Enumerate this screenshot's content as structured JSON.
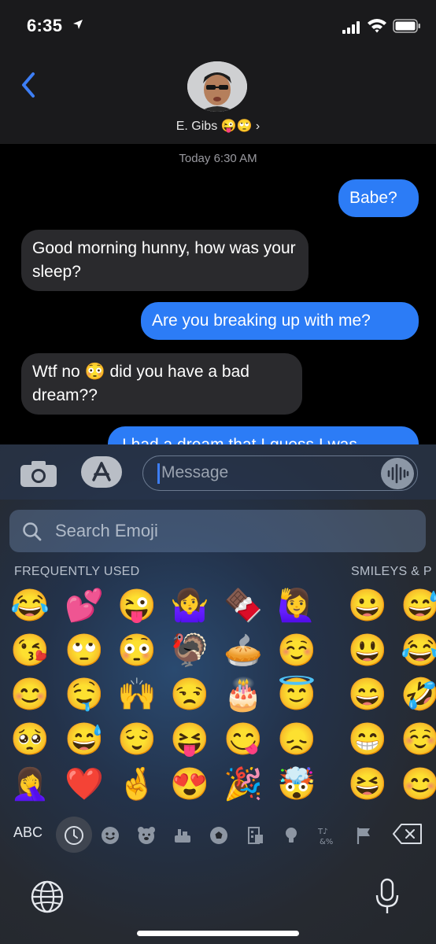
{
  "status_bar": {
    "time": "6:35"
  },
  "header": {
    "contact_name": "E. Gibs 😜🙄 ›"
  },
  "conversation": {
    "timestamp": "Today 6:30 AM",
    "messages": [
      {
        "from": "me",
        "text": "Babe?"
      },
      {
        "from": "them",
        "text": "Good morning hunny, how was your sleep?"
      },
      {
        "from": "me",
        "text": "Are you breaking up with me?"
      },
      {
        "from": "them",
        "text": "Wtf no 😳 did you have a bad dream??"
      },
      {
        "from": "me",
        "text": "I had a dream that I guess I was"
      }
    ]
  },
  "composer": {
    "placeholder": "Message"
  },
  "emoji_keyboard": {
    "search_placeholder": "Search Emoji",
    "section_frequent": "FREQUENTLY USED",
    "section_smileys": "SMILEYS & P",
    "frequent_rows": [
      [
        "😂",
        "💕",
        "😜",
        "🤷‍♀️",
        "🍫",
        "🙋‍♀️"
      ],
      [
        "😘",
        "🙄",
        "😳",
        "🦃",
        "🥧",
        "☺️"
      ],
      [
        "😊",
        "🤤",
        "🙌",
        "😒",
        "🎂",
        "😇"
      ],
      [
        "🥺",
        "😅",
        "😌",
        "😝",
        "😋",
        "😞"
      ],
      [
        "🤦‍♀️",
        "❤️",
        "🤞",
        "😍",
        "🎉",
        "🤯"
      ]
    ],
    "smileys_rows": [
      [
        "😀",
        "😅"
      ],
      [
        "😃",
        "😂"
      ],
      [
        "😄",
        "🤣"
      ],
      [
        "😁",
        "☺️"
      ],
      [
        "😆",
        "😊"
      ]
    ],
    "abc_label": "ABC",
    "category_icons": [
      "clock-icon",
      "smiley-icon",
      "bear-icon",
      "food-icon",
      "ball-icon",
      "building-icon",
      "lightbulb-icon",
      "symbols-icon",
      "flag-icon"
    ]
  },
  "colors": {
    "sent_bubble": "#2c7cf6",
    "received_bubble": "#2a2a2d",
    "accent": "#3d7ef5"
  }
}
